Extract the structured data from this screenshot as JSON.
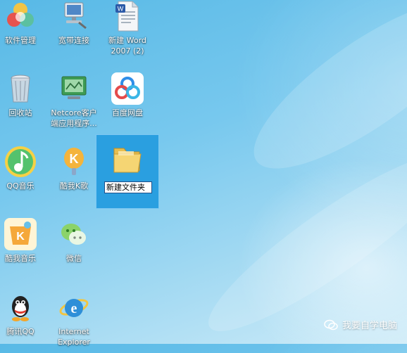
{
  "desktop": {
    "icons": [
      {
        "label": "软件管理",
        "icon": "software-manager-icon"
      },
      {
        "label": "宽带连接",
        "icon": "broadband-connection-icon"
      },
      {
        "label": "新建 Word\n2007 (2)",
        "icon": "word-document-icon"
      },
      {
        "label": "回收站",
        "icon": "recycle-bin-icon"
      },
      {
        "label": "Netcore客户\n端应用程序...",
        "icon": "netcore-client-icon"
      },
      {
        "label": "百度网盘",
        "icon": "baidu-netdisk-icon"
      },
      {
        "label": "QQ音乐",
        "icon": "qq-music-icon"
      },
      {
        "label": "酷我K歌",
        "icon": "kuwo-karaoke-icon"
      },
      {
        "label": "酷我音乐",
        "icon": "kuwo-music-icon"
      },
      {
        "label": "微信",
        "icon": "wechat-icon"
      },
      {
        "label": "腾讯QQ",
        "icon": "tencent-qq-icon"
      },
      {
        "label": "Internet\nExplorer",
        "icon": "internet-explorer-icon"
      }
    ],
    "new_folder": {
      "icon": "folder-icon",
      "rename_value": "新建文件夹"
    }
  },
  "watermark": {
    "text": "我要自学电脑"
  },
  "colors": {
    "selection": "#2a9fe0",
    "wallpaper_top": "#58b9e6",
    "wallpaper_bottom": "#cdebf8"
  }
}
